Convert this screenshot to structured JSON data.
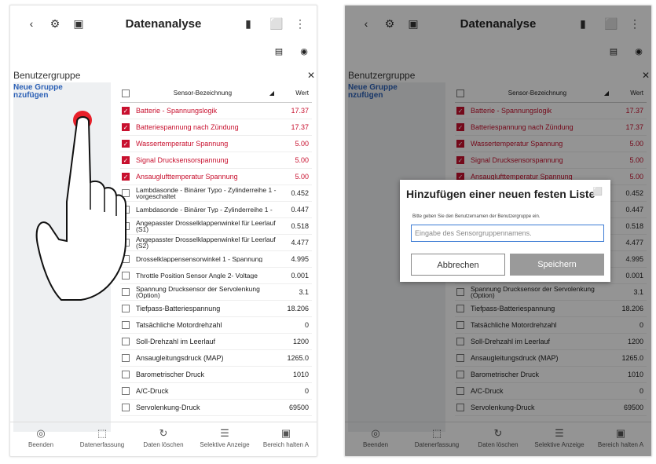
{
  "screen": {
    "title": "Datenanalyse",
    "back_icon": "chevron-left-icon",
    "group_header": "Benutzergruppe",
    "new_group": "Neue Gruppe\nnzufügen",
    "table_headers": {
      "name": "Sensor-Bezeichnung",
      "value": "Wert"
    },
    "rows_left": [
      {
        "label": "Batterie - Spannungslogik",
        "value": "17.37",
        "checked": true
      },
      {
        "label": "Batteriespannung nach Zündung",
        "value": "17.37",
        "checked": true
      },
      {
        "label": "Wassertemperatur Spannung",
        "value": "5.00",
        "checked": true
      },
      {
        "label": "Signal Drucksensorspannung",
        "value": "5.00",
        "checked": true
      },
      {
        "label": "Ansauglufttemperatur Spannung",
        "value": "5.00",
        "checked": true
      },
      {
        "label": "Lambdasonde - Binärer Typo - Zylinderreihe 1 - vorgeschaltet",
        "value": "0.452",
        "checked": false
      },
      {
        "label": "Lambdasonde - Binärer Typ - Zylinderreihe 1 -",
        "value": "0.447",
        "checked": false
      },
      {
        "label": "Angepasster Drosselklappenwinkel für Leerlauf (S1)",
        "value": "0.518",
        "checked": false
      },
      {
        "label": "Angepasster Drosselklappenwinkel für Leerlauf (S2)",
        "value": "4.477",
        "checked": false
      },
      {
        "label": "Drosselklappensensorwinkel 1 - Spannung",
        "value": "4.995",
        "checked": false
      },
      {
        "label": "Throttle Position Sensor Angle 2- Voltage",
        "value": "0.001",
        "checked": false
      },
      {
        "label": "Spannung Drucksensor der Servolenkung (Option)",
        "value": "3.1",
        "checked": false
      },
      {
        "label": "Tiefpass-Batteriespannung",
        "value": "18.206",
        "checked": false
      },
      {
        "label": "Tatsächliche Motordrehzahl",
        "value": "0",
        "checked": false
      },
      {
        "label": "Soll-Drehzahl im Leerlauf",
        "value": "1200",
        "checked": false
      },
      {
        "label": "Ansaugleitungsdruck (MAP)",
        "value": "1265.0",
        "checked": false
      },
      {
        "label": "Barometrischer Druck",
        "value": "1010",
        "checked": false
      },
      {
        "label": "A/C-Druck",
        "value": "0",
        "checked": false
      },
      {
        "label": "Servolenkung-Druck",
        "value": "69500",
        "checked": false
      }
    ],
    "bottom": [
      {
        "label": "Beenden",
        "icon": "stop-icon"
      },
      {
        "label": "Datenerfassung",
        "icon": "capture-icon"
      },
      {
        "label": "Daten löschen",
        "icon": "refresh-icon"
      },
      {
        "label": "Selektive Anzeige",
        "icon": "list-icon"
      },
      {
        "label": "Bereich halten A",
        "icon": "hold-icon"
      }
    ]
  },
  "dialog": {
    "title": "Hinzufügen einer neuen festen Liste",
    "hint": "Bitte geben Sie den Benutzernamen der Benutzergruppe ein.",
    "placeholder": "Eingabe des Sensorgruppennamens.",
    "cancel": "Abbrechen",
    "save": "Speichern"
  },
  "colors": {
    "accent_red": "#c8102e",
    "link_blue": "#2a5fb5"
  }
}
